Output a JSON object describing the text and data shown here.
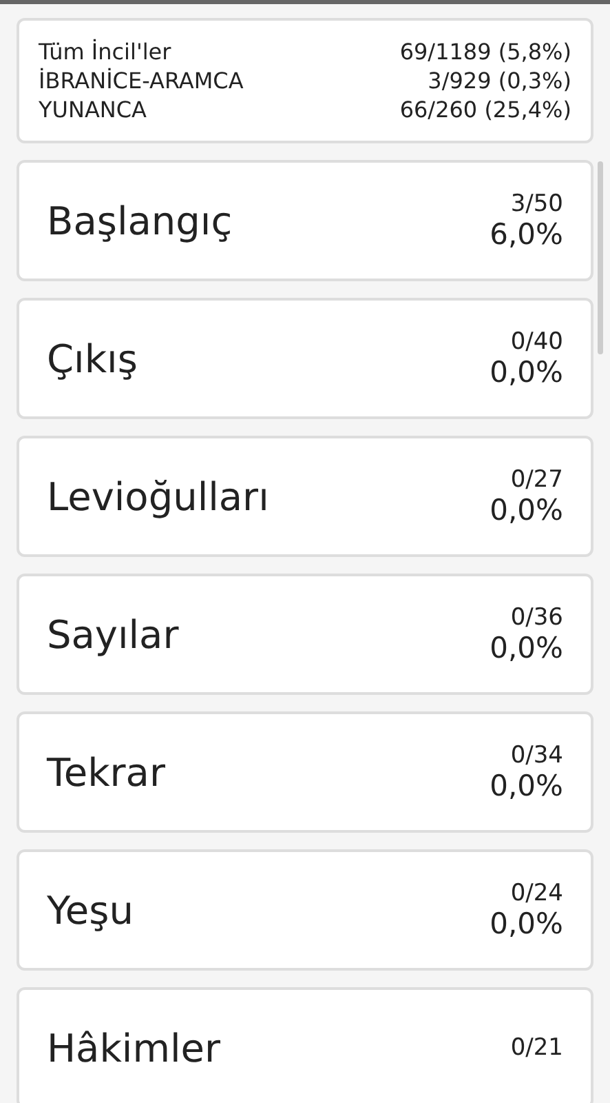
{
  "summary": [
    {
      "label": "Tüm İncil'ler",
      "value": "69/1189 (5,8%)"
    },
    {
      "label": "İBRANİCE-ARAMCA",
      "value": "3/929 (0,3%)"
    },
    {
      "label": "YUNANCA",
      "value": "66/260 (25,4%)"
    }
  ],
  "books": [
    {
      "title": "Başlangıç",
      "count": "3/50",
      "percent": "6,0%"
    },
    {
      "title": "Çıkış",
      "count": "0/40",
      "percent": "0,0%"
    },
    {
      "title": "Levioğulları",
      "count": "0/27",
      "percent": "0,0%"
    },
    {
      "title": "Sayılar",
      "count": "0/36",
      "percent": "0,0%"
    },
    {
      "title": "Tekrar",
      "count": "0/34",
      "percent": "0,0%"
    },
    {
      "title": "Yeşu",
      "count": "0/24",
      "percent": "0,0%"
    },
    {
      "title": "Hâkimler",
      "count": "0/21"
    }
  ]
}
